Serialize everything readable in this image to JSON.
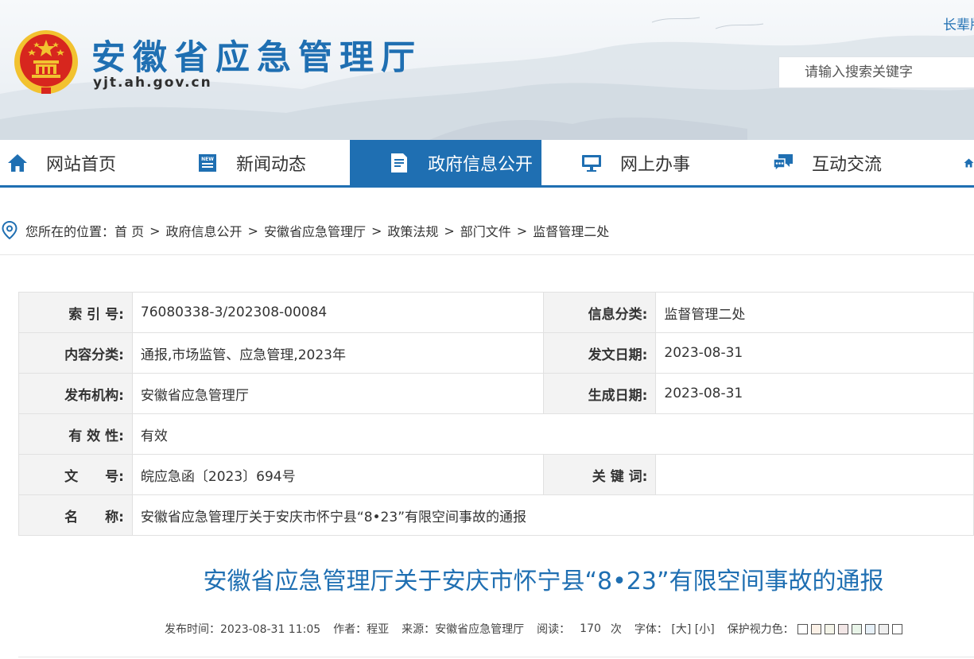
{
  "header": {
    "site_name": "安徽省应急管理厅",
    "site_domain": "yjt.ah.gov.cn",
    "top_link": "长辈版",
    "search_placeholder": "请输入搜索关键字"
  },
  "nav": {
    "items": [
      {
        "label": "网站首页",
        "icon": "home-icon"
      },
      {
        "label": "新闻动态",
        "icon": "news-icon"
      },
      {
        "label": "政府信息公开",
        "icon": "document-icon",
        "active": true
      },
      {
        "label": "网上办事",
        "icon": "monitor-icon"
      },
      {
        "label": "互动交流",
        "icon": "chat-icon"
      }
    ]
  },
  "breadcrumb": {
    "prefix": "您所在的位置：",
    "items": [
      "首 页",
      "政府信息公开",
      "安徽省应急管理厅",
      "政策法规",
      "部门文件",
      "监督管理二处"
    ],
    "separator": ">"
  },
  "info": {
    "index_no": {
      "label": "索 引 号:",
      "value": "76080338-3/202308-00084"
    },
    "info_category": {
      "label": "信息分类:",
      "value": "监督管理二处"
    },
    "content_category": {
      "label": "内容分类:",
      "value": "通报,市场监管、应急管理,2023年"
    },
    "issue_date": {
      "label": "发文日期:",
      "value": "2023-08-31"
    },
    "publisher": {
      "label": "发布机构:",
      "value": "安徽省应急管理厅"
    },
    "generated_date": {
      "label": "生成日期:",
      "value": "2023-08-31"
    },
    "validity": {
      "label": "有 效 性:",
      "value": "有效"
    },
    "doc_no": {
      "label": "文　　号:",
      "value": "皖应急函〔2023〕694号"
    },
    "keywords": {
      "label": "关 键 词:",
      "value": ""
    },
    "name": {
      "label": "名　　称:",
      "value": "安徽省应急管理厅关于安庆市怀宁县“8•23”有限空间事故的通报"
    }
  },
  "article": {
    "title": "安徽省应急管理厅关于安庆市怀宁县“8•23”有限空间事故的通报",
    "publish_time": "发布时间：2023-08-31 11:05",
    "author": "作者：程亚",
    "source": "来源：安徽省应急管理厅",
    "reads_label": "阅读：",
    "reads_count": "170",
    "reads_unit": "次",
    "font_label": "字体：",
    "font_large": "[大]",
    "font_small": "[小]",
    "eye_color_label": "保护视力色：",
    "eye_colors": [
      "#ffffff",
      "#fbf0e6",
      "#f4f4e8",
      "#f2e6e6",
      "#e8f4e8",
      "#e6f0f8",
      "#eeeeee",
      "#ffffff"
    ]
  },
  "colors": {
    "brand_blue": "#1f6fb2",
    "emblem_red": "#d7261e",
    "emblem_gold": "#f2c230"
  }
}
